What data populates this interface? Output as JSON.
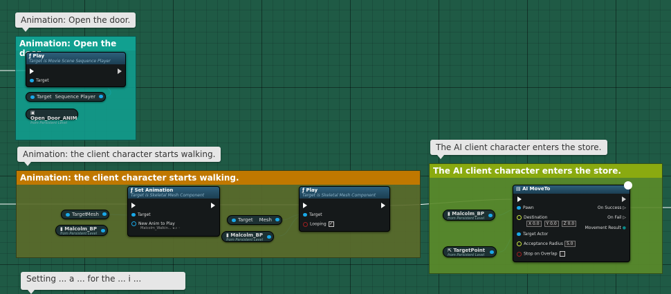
{
  "comments": {
    "door": {
      "bubble": "Animation: Open the door.",
      "header": "Animation: Open the door."
    },
    "walk": {
      "bubble": "Animation: the client character starts walking.",
      "header": "Animation: the client character starts walking."
    },
    "store": {
      "bubble": "The AI client character enters the store.",
      "header": "The AI client character enters the store."
    },
    "bottom_partial": "Setting ... a ... for the ... i ..."
  },
  "nodes": {
    "play1": {
      "title": "Play",
      "subtitle": "Target is Movie Scene Sequence Player",
      "target": "Target"
    },
    "target_seq": {
      "left": "Target",
      "right": "Sequence Player"
    },
    "open_door_anim": {
      "name": "Open_Door_ANIM",
      "sub": "from Persistent Level"
    },
    "target_mesh1": {
      "left": "Target",
      "right": "Mesh"
    },
    "malcolm1": {
      "name": "Malcolm_BP",
      "sub": "from Persistent Level"
    },
    "set_animation": {
      "title": "Set Animation",
      "subtitle": "Target is Skeletal Mesh Component",
      "target": "Target",
      "new_anim": "New Anim to Play",
      "anim_value": "Malcolm_Walkin..."
    },
    "target_mesh2": {
      "left": "Target",
      "right": "Mesh"
    },
    "malcolm2": {
      "name": "Malcolm_BP",
      "sub": "from Persistent Level"
    },
    "play2": {
      "title": "Play",
      "subtitle": "Target is Skeletal Mesh Component",
      "target": "Target",
      "looping": "Looping",
      "looping_checked": "✓"
    },
    "malcolm3": {
      "name": "Malcolm_BP",
      "sub": "from Persistent Level"
    },
    "target_point": {
      "name": "TargetPoint",
      "sub": "from Persistent Level"
    },
    "ai_move_to": {
      "title": "AI MoveTo",
      "pawn": "Pawn",
      "destination": "Destination",
      "dest_x_label": "X",
      "dest_x": "0.0",
      "dest_y_label": "Y",
      "dest_y": "0.0",
      "dest_z_label": "Z",
      "dest_z": "0.0",
      "target_actor": "Target Actor",
      "acceptance_radius": "Acceptance Radius",
      "acceptance_value": "5.0",
      "stop_on_overlap": "Stop on Overlap",
      "on_success": "On Success",
      "on_fail": "On Fail",
      "movement_result": "Movement Result"
    }
  },
  "colors": {
    "door_comment": "#11a090",
    "walk_header": "#c07800",
    "walk_body": "#5a6a2a",
    "store_header": "#8aaa10",
    "store_body": "#5a8a2a",
    "object_pin": "#19a8e8",
    "vector_pin": "#cce840"
  }
}
